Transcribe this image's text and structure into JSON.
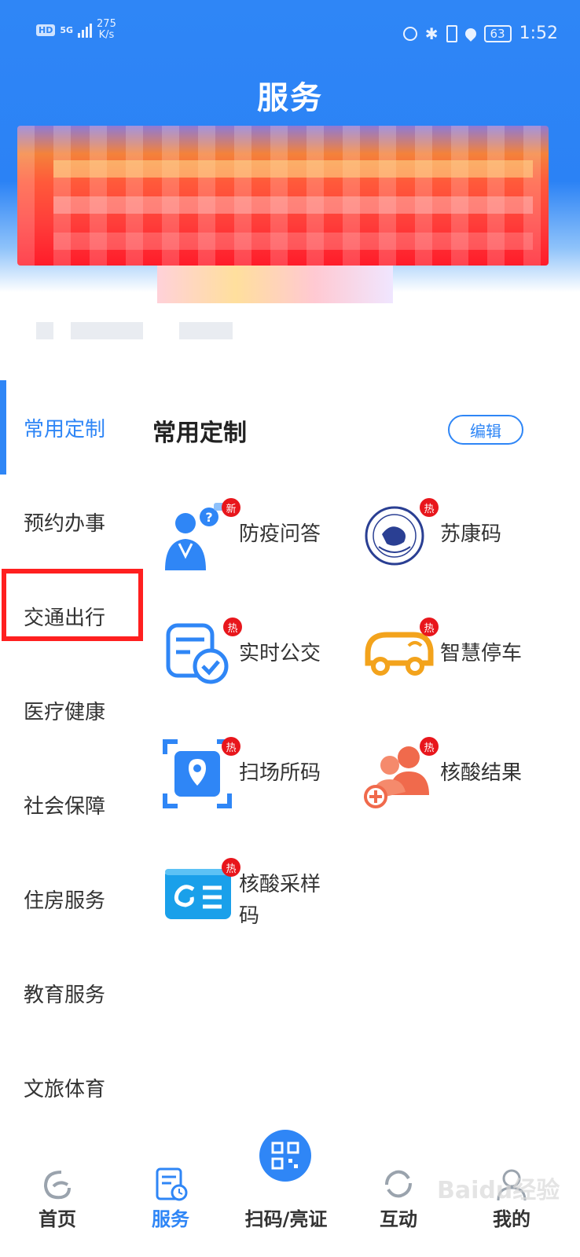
{
  "status_bar": {
    "hd": "HD",
    "network": "5G",
    "speed_value": "275",
    "speed_unit": "K/s",
    "battery": "63",
    "time": "1:52"
  },
  "header": {
    "title": "服务"
  },
  "sidebar": {
    "items": [
      {
        "label": "常用定制"
      },
      {
        "label": "预约办事"
      },
      {
        "label": "交通出行"
      },
      {
        "label": "医疗健康"
      },
      {
        "label": "社会保障"
      },
      {
        "label": "住房服务"
      },
      {
        "label": "教育服务"
      },
      {
        "label": "文旅体育"
      }
    ]
  },
  "section": {
    "title": "常用定制",
    "edit_label": "编辑"
  },
  "services": [
    {
      "label": "防疫问答",
      "badge": "新",
      "icon": "doctor-qa-icon"
    },
    {
      "label": "苏康码",
      "badge": "热",
      "icon": "health-code-seal-icon"
    },
    {
      "label": "实时公交",
      "badge": "热",
      "icon": "bus-check-icon"
    },
    {
      "label": "智慧停车",
      "badge": "热",
      "icon": "smart-parking-car-icon"
    },
    {
      "label": "扫场所码",
      "badge": "热",
      "icon": "scan-location-icon"
    },
    {
      "label": "核酸结果",
      "badge": "热",
      "icon": "nucleic-result-people-icon"
    },
    {
      "label": "核酸采样码",
      "badge": "热",
      "icon": "sampling-card-icon"
    }
  ],
  "tabbar": {
    "items": [
      {
        "label": "首页",
        "icon": "home-logo-icon"
      },
      {
        "label": "服务",
        "icon": "service-doc-icon"
      },
      {
        "label": "扫码/亮证",
        "icon": "qr-code-icon"
      },
      {
        "label": "互动",
        "icon": "refresh-icon"
      },
      {
        "label": "我的",
        "icon": "profile-icon"
      }
    ]
  },
  "colors": {
    "primary": "#2f86f6",
    "badge": "#e8161c",
    "highlight": "#ff1f1f"
  },
  "watermark": "Baidu经验"
}
